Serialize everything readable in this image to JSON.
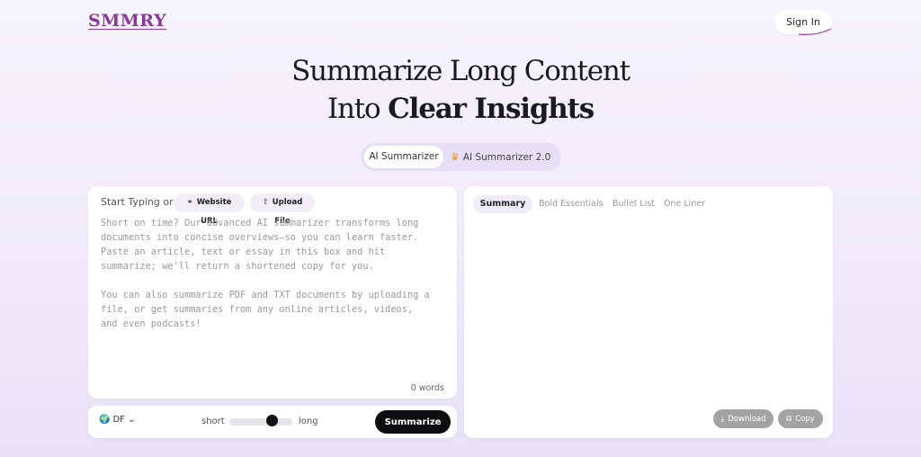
{
  "header": {
    "logo": "SMMRY",
    "signin_label": "Sign In"
  },
  "hero": {
    "line1": "Summarize Long Content",
    "line2_part1": "Into ",
    "line2_part2": "Clear Insights"
  },
  "mode_switch": {
    "options": [
      {
        "label": "AI Summarizer",
        "active": true
      },
      {
        "label": "AI Summarizer 2.0",
        "icon": "crown-icon",
        "active": false
      }
    ]
  },
  "input_panel": {
    "start_label": "Start Typing or",
    "website_url_label": "Website URL",
    "upload_file_label": "Upload File",
    "placeholder_lines": [
      "Short on time? Our advanced AI summarizer transforms long",
      "documents into concise overviews—so you can learn faster.",
      "Paste an article, text or essay in this box and hit",
      "summarize; we'll return a shortened copy for you.",
      "",
      "You can also summarize PDF and TXT documents by uploading a",
      "file, or get summaries from any online articles, videos,",
      "and even podcasts!"
    ],
    "word_count": "0 words"
  },
  "controls": {
    "language": "DF",
    "length_short_label": "short",
    "length_long_label": "long",
    "length_value": 0.65,
    "summarize_label": "Summarize"
  },
  "output_panel": {
    "tabs": [
      {
        "label": "Summary",
        "active": true
      },
      {
        "label": "Bold Essentials",
        "active": false
      },
      {
        "label": "Bullet List",
        "active": false
      },
      {
        "label": "One Liner",
        "active": false
      }
    ],
    "download_label": "Download",
    "copy_label": "Copy"
  },
  "colors": {
    "logo": "#8a3a9a",
    "accent_dark": "#0d0d0f",
    "crown": "#e79a24"
  }
}
